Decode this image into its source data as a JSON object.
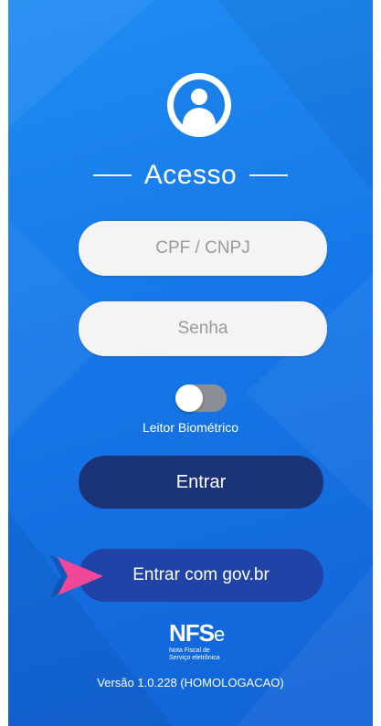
{
  "login": {
    "title": "Acesso",
    "cpf_placeholder": "CPF / CNPJ",
    "password_placeholder": "Senha",
    "biometric_label": "Leitor Biométrico",
    "biometric_enabled": false,
    "login_button": "Entrar",
    "gov_button": "Entrar com gov.br"
  },
  "branding": {
    "logo_main": "NFS",
    "logo_suffix": "e",
    "logo_sub_line1": "Nota Fiscal de",
    "logo_sub_line2": "Serviço eletrônica",
    "version": "Versão 1.0.228 (HOMOLOGACAO)"
  },
  "colors": {
    "background": "#1677e8",
    "login_button": "#1b3478",
    "gov_button": "#1f43a6",
    "arrow": "#f0479a"
  },
  "icons": [
    "user-avatar-icon",
    "arrow-pointer-icon"
  ]
}
